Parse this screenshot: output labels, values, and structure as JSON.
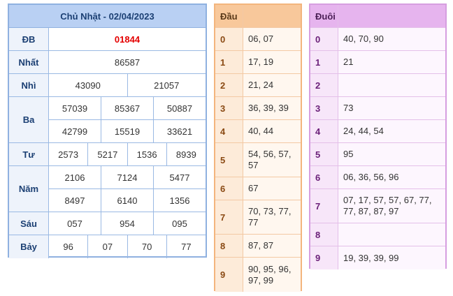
{
  "results": {
    "title": "Chủ Nhật - 02/04/2023",
    "prizes": [
      {
        "label": "ĐB",
        "lines": [
          [
            "01844"
          ]
        ],
        "special": true
      },
      {
        "label": "Nhất",
        "lines": [
          [
            "86587"
          ]
        ]
      },
      {
        "label": "Nhì",
        "lines": [
          [
            "43090",
            "21057"
          ]
        ]
      },
      {
        "label": "Ba",
        "lines": [
          [
            "57039",
            "85367",
            "50887"
          ],
          [
            "42799",
            "15519",
            "33621"
          ]
        ]
      },
      {
        "label": "Tư",
        "lines": [
          [
            "2573",
            "5217",
            "1536",
            "8939"
          ]
        ]
      },
      {
        "label": "Năm",
        "lines": [
          [
            "2106",
            "7124",
            "5477"
          ],
          [
            "8497",
            "6140",
            "1356"
          ]
        ]
      },
      {
        "label": "Sáu",
        "lines": [
          [
            "057",
            "954",
            "095"
          ]
        ]
      },
      {
        "label": "Bảy",
        "lines": [
          [
            "96",
            "07",
            "70",
            "77"
          ]
        ]
      }
    ]
  },
  "dau": {
    "header": [
      "Đầu",
      ""
    ],
    "rows": [
      {
        "key": "0",
        "value": "06, 07"
      },
      {
        "key": "1",
        "value": "17, 19"
      },
      {
        "key": "2",
        "value": "21, 24"
      },
      {
        "key": "3",
        "value": "36, 39, 39"
      },
      {
        "key": "4",
        "value": "40, 44"
      },
      {
        "key": "5",
        "value": "54, 56, 57, 57"
      },
      {
        "key": "6",
        "value": "67"
      },
      {
        "key": "7",
        "value": "70, 73, 77, 77"
      },
      {
        "key": "8",
        "value": "87, 87"
      },
      {
        "key": "9",
        "value": "90, 95, 96, 97, 99"
      }
    ]
  },
  "duoi": {
    "header": [
      "Đuôi",
      ""
    ],
    "rows": [
      {
        "key": "0",
        "value": "40, 70, 90"
      },
      {
        "key": "1",
        "value": "21"
      },
      {
        "key": "2",
        "value": ""
      },
      {
        "key": "3",
        "value": "73"
      },
      {
        "key": "4",
        "value": "24, 44, 54"
      },
      {
        "key": "5",
        "value": "95"
      },
      {
        "key": "6",
        "value": "06, 36, 56, 96"
      },
      {
        "key": "7",
        "value": "07, 17, 57, 57, 67, 77, 77, 87, 87, 97"
      },
      {
        "key": "8",
        "value": ""
      },
      {
        "key": "9",
        "value": "19, 39, 39, 99"
      }
    ]
  },
  "colors": {
    "results_border": "#8fb1e0",
    "results_header": "#b9d0f3",
    "special_prize": "#e40000",
    "dau_border": "#f3b57d",
    "duoi_border": "#d69ee0"
  }
}
